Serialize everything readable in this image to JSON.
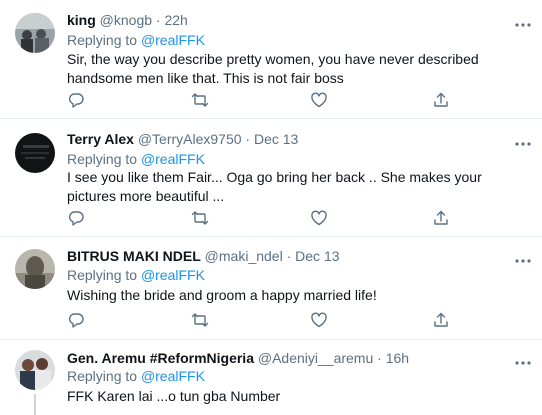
{
  "tweets": [
    {
      "name": "king",
      "handle": "@knogb",
      "sep": "·",
      "time": "22h",
      "replying_prefix": "Replying to ",
      "replying_to": "@realFFK",
      "text": "Sir, the way you describe pretty women, you have never described handsome men like that. This is not fair boss"
    },
    {
      "name": "Terry Alex",
      "handle": "@TerryAlex9750",
      "sep": "·",
      "time": "Dec 13",
      "replying_prefix": "Replying to ",
      "replying_to": "@realFFK",
      "text": "I see you like them Fair... Oga go bring her back .. She makes your pictures more beautiful ..."
    },
    {
      "name": "BITRUS MAKI NDEL",
      "handle": "@maki_ndel",
      "sep": "·",
      "time": "Dec 13",
      "replying_prefix": "Replying to ",
      "replying_to": "@realFFK",
      "text": "Wishing the bride and groom a happy married life!"
    },
    {
      "name": "Gen. Aremu #ReformNigeria",
      "handle": "@Adeniyi__aremu",
      "sep": "·",
      "time": "16h",
      "replying_prefix": "Replying to ",
      "replying_to": "@realFFK",
      "text": "FFK Karen lai ...o tun gba Number"
    }
  ],
  "icons": {
    "reply": "reply-icon",
    "retweet": "retweet-icon",
    "like": "like-icon",
    "share": "share-icon",
    "more": "more-icon"
  },
  "colors": {
    "link": "#1b95e0",
    "secondary_text": "#5b7083",
    "divider": "#e6ecf0"
  }
}
